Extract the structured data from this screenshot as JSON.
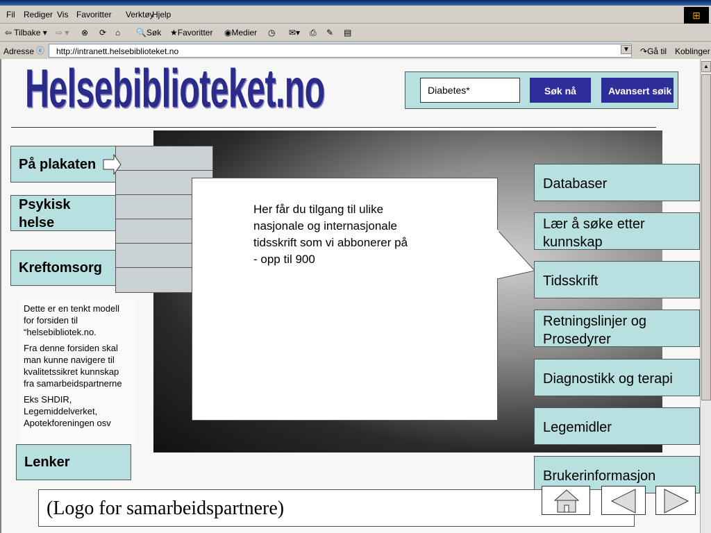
{
  "browser": {
    "menu": [
      "Fil",
      "Rediger",
      "Vis",
      "Favoritter",
      "Verktøy",
      "Hjelp"
    ],
    "toolbar": {
      "back": "⇦ Tilbake ▾",
      "forward": "⇨ ▾",
      "search": "Søk",
      "favorites": "Favoritter",
      "media": "Medier"
    },
    "address_label": "Adresse",
    "address": "http://intranett.helsebiblioteket.no",
    "go": "Gå til",
    "links": "Koblinger"
  },
  "page": {
    "logo": "Helsebiblioteket.no",
    "search": {
      "value": "Diabetes*",
      "search_button": "Søk nå",
      "advanced_button": "Avansert søik"
    },
    "left_menu": [
      "På plakaten",
      "Psykisk helse",
      "Kreftomsorg"
    ],
    "callout": [
      "Her får du tilgang til ulike nasjonale og internasjonale tidsskrift som vi abbonerer på",
      "- opp til 900"
    ],
    "right_menu": [
      "Databaser",
      "Lær å søke etter kunnskap",
      "Tidsskrift",
      "Retningslinjer og Prosedyrer",
      "Diagnostikk og terapi",
      "Legemidler",
      "Brukerinformasjon"
    ],
    "note": [
      "Dette er en tenkt modell for forsiden til “helsebibliotek.no.",
      "Fra denne forsiden skal man kunne navigere til kvalitetssikret kunnskap fra samarbeidspartnerne",
      "Eks SHDIR, Legemiddelverket, Apotekforeningen osv"
    ],
    "links": "Lenker",
    "footer": "(Logo for samarbeidspartnere)"
  },
  "colors": {
    "button_bg": "#b9e0e1",
    "search_button": "#2e2e9a",
    "logo": "#2b2b8c"
  }
}
